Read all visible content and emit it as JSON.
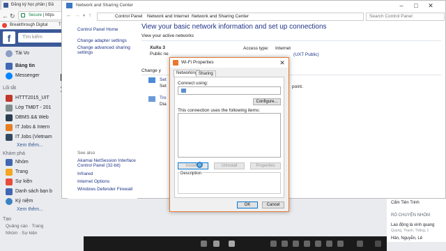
{
  "browser": {
    "tab_title": "Đăng ký học phần | Đă",
    "address_secure": "Secure",
    "address_text": "https",
    "bookmark1": "Breakthrough Digital",
    "bookmark2": "Thu"
  },
  "facebook": {
    "search_placeholder": "Tìm kiếm",
    "user_name": "Tài Vo",
    "nav": [
      "Bảng tin",
      "Messenger"
    ],
    "shortcuts_heading": "Lối tắt",
    "shortcuts": [
      "HTTT2015_UIT",
      "Lớp TMĐT - 201",
      "DBMS && Web",
      "IT Jobs & Intern",
      "IT Jobs (Vietnam"
    ],
    "see_more": "Xem thêm...",
    "explore_heading": "Khám phá",
    "explore": [
      "Nhóm",
      "Trang",
      "Sự kiện",
      "Danh sách bạn b",
      "Kỷ niệm"
    ],
    "create_heading": "Tạo",
    "create_links": "Quảng cáo · Trang",
    "footer": "Nhóm · Sự kiện",
    "chat_text": "b",
    "emoticon": ":)"
  },
  "nsc": {
    "window_title": "Network and Sharing Center",
    "breadcrumbs": [
      "Control Panel",
      "Network and Internet",
      "Network and Sharing Center"
    ],
    "search_placeholder": "Search Control Panel",
    "left_links": [
      "Control Panel Home",
      "Change adapter settings",
      "Change advanced sharing settings"
    ],
    "see_also_heading": "See also",
    "see_also": [
      "Akamai NetSession Interface Control Panel (32-bit)",
      "Infrared",
      "Internet Options",
      "Windows Defender Firewall"
    ],
    "main_title": "View your basic network information and set up connections",
    "active_networks_label": "View your active networks",
    "network_name": "XuXu 3",
    "network_type": "Public ne",
    "access_type_label": "Access type:",
    "access_type_value": "Internet",
    "connections_value": "(UXT Public)",
    "change_settings_label": "Change y",
    "setup_short": "Set",
    "set_short2": "Set",
    "trouble_short": "Tro",
    "diag_short": "Dia",
    "point_text": "point."
  },
  "dialog": {
    "title": "Wi-Fi Properties",
    "tabs": [
      "Networking",
      "Sharing"
    ],
    "connect_using_label": "Connect using:",
    "configure_button": "Configure...",
    "items_label": "This connection uses the following items:",
    "install_button": "Install...",
    "uninstall_button": "Uninstall",
    "properties_button": "Properties",
    "description_label": "Description",
    "ok_button": "OK",
    "cancel_button": "Cancel"
  },
  "right_panel": {
    "line1": "Cẩm Tiên Trinh",
    "heading": "RÒ CHUYỆN NHÓM",
    "line2": "Lao động là vinh quang",
    "line3": "Quang, Thanh, Thắng, 1",
    "line4": "Hân, Nguyễn, Lê"
  },
  "colors": {
    "facebook_blue": "#3b5998",
    "link_blue": "#1e3287",
    "dialog_accent": "#e8772e"
  }
}
